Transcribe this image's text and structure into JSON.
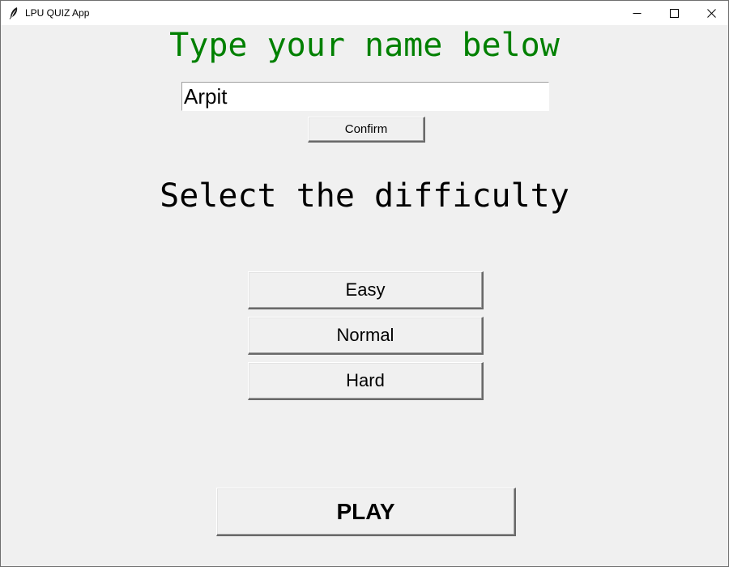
{
  "window": {
    "title": "LPU QUIZ App"
  },
  "name_section": {
    "heading": "Type your name below",
    "heading_color": "#008000",
    "input_value": "Arpit",
    "confirm_label": "Confirm"
  },
  "difficulty_section": {
    "heading": "Select the difficulty",
    "options": [
      {
        "label": "Easy"
      },
      {
        "label": "Normal"
      },
      {
        "label": "Hard"
      }
    ]
  },
  "play_label": "PLAY",
  "icons": {
    "app": "feather-icon",
    "minimize": "minimize-icon",
    "maximize": "maximize-icon",
    "close": "close-icon"
  }
}
